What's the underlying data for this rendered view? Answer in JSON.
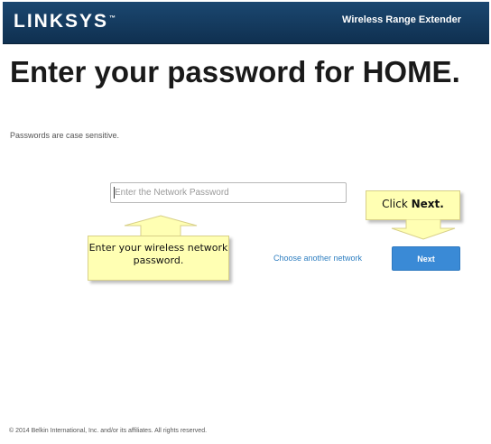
{
  "header": {
    "logo_text": "LINKSYS",
    "logo_tm": "™",
    "product_name": "Wireless Range Extender"
  },
  "main": {
    "title": "Enter your password for HOME.",
    "subtitle": "Passwords are case sensitive.",
    "password_placeholder": "Enter the Network Password",
    "choose_network_link": "Choose another network",
    "next_button": "Next"
  },
  "callouts": {
    "password_hint": "Enter your wireless network password.",
    "next_hint_prefix": "Click",
    "next_hint_bold": "Next."
  },
  "footer": {
    "copyright": "© 2014 Belkin International, Inc. and/or its affiliates. All rights reserved."
  },
  "colors": {
    "header_bg": "#143b5c",
    "next_button_bg": "#3a8ad6",
    "link": "#2f7fc1",
    "callout_bg": "#ffffb3"
  }
}
